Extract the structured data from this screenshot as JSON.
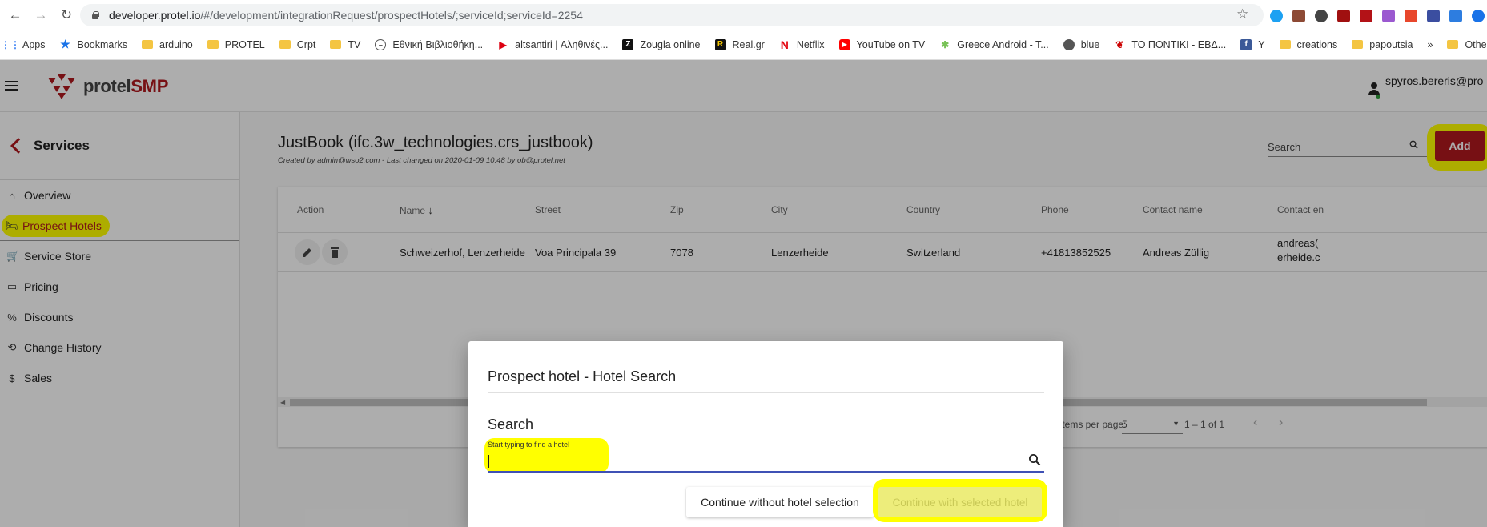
{
  "browser": {
    "url_host": "developer.protel.io",
    "url_path": "/#/development/integrationRequest/prospectHotels/;serviceId;serviceId=2254",
    "bookmarks": [
      {
        "label": "Apps",
        "icon": "apps-icon"
      },
      {
        "label": "Bookmarks",
        "icon": "star-icon"
      },
      {
        "label": "arduino",
        "icon": "folder-icon"
      },
      {
        "label": "PROTEL",
        "icon": "folder-icon"
      },
      {
        "label": "Crpt",
        "icon": "folder-icon"
      },
      {
        "label": "TV",
        "icon": "folder-icon"
      },
      {
        "label": "Εθνική Βιβλιοθήκη...",
        "icon": "globe-icon"
      },
      {
        "label": "altsantiri | Αληθινές...",
        "icon": "play-icon"
      },
      {
        "label": "Zougla online",
        "icon": "z-icon"
      },
      {
        "label": "Real.gr",
        "icon": "r-icon"
      },
      {
        "label": "Netflix",
        "icon": "netflix-icon"
      },
      {
        "label": "YouTube on TV",
        "icon": "youtube-icon"
      },
      {
        "label": "Greece Android - T...",
        "icon": "android-icon"
      },
      {
        "label": "blue",
        "icon": "globe-icon"
      },
      {
        "label": "ΤΟ ΠΟΝΤΙΚΙ - ΕΒΔ...",
        "icon": "mouse-icon"
      },
      {
        "label": "Υ",
        "icon": "facebook-icon"
      },
      {
        "label": "creations",
        "icon": "folder-icon"
      },
      {
        "label": "papoutsia",
        "icon": "folder-icon"
      },
      {
        "label": "»",
        "icon": ""
      },
      {
        "label": "Other bo",
        "icon": "folder-icon"
      }
    ]
  },
  "app": {
    "logo_prefix": "protel",
    "logo_suffix": "SMP",
    "user_name": "spyros.bereris@pro"
  },
  "sidebar": {
    "back_label": "Services",
    "items": [
      {
        "label": "Overview",
        "icon": "home-icon"
      },
      {
        "label": "Prospect Hotels",
        "icon": "bed-icon"
      },
      {
        "label": "Service Store",
        "icon": "cart-icon"
      },
      {
        "label": "Pricing",
        "icon": "card-icon"
      },
      {
        "label": "Discounts",
        "icon": "discount-icon"
      },
      {
        "label": "Change History",
        "icon": "history-icon"
      },
      {
        "label": "Sales",
        "icon": "dollar-icon"
      }
    ]
  },
  "main": {
    "title": "JustBook (ifc.3w_technologies.crs_justbook)",
    "subtitle": "Created by admin@wso2.com - Last changed on 2020-01-09 10:48 by ob@protel.net",
    "search_placeholder": "Search",
    "add_label": "Add",
    "columns": [
      "Action",
      "Name",
      "Street",
      "Zip",
      "City",
      "Country",
      "Phone",
      "Contact name",
      "Contact en"
    ],
    "row": {
      "name": "Schweizerhof, Lenzerheide",
      "street": "Voa Principala 39",
      "zip": "7078",
      "city": "Lenzerheide",
      "country": "Switzerland",
      "phone": "+41813852525",
      "contact_name": "Andreas Züllig",
      "contact_email_1": "andreas(",
      "contact_email_2": "erheide.c"
    },
    "paginator": {
      "items_per_page_label": "Items per page:",
      "items_per_page_value": "5",
      "range": "1 – 1 of 1"
    }
  },
  "modal": {
    "title": "Prospect hotel - Hotel Search",
    "search_heading": "Search",
    "field_label": "Start typing to find a hotel",
    "field_value": "",
    "btn_without": "Continue without hotel selection",
    "btn_with": "Continue with selected hotel"
  },
  "colors": {
    "brand_red": "#b0191e",
    "highlight": "#ffff00",
    "input_underline": "#3f51b5"
  }
}
